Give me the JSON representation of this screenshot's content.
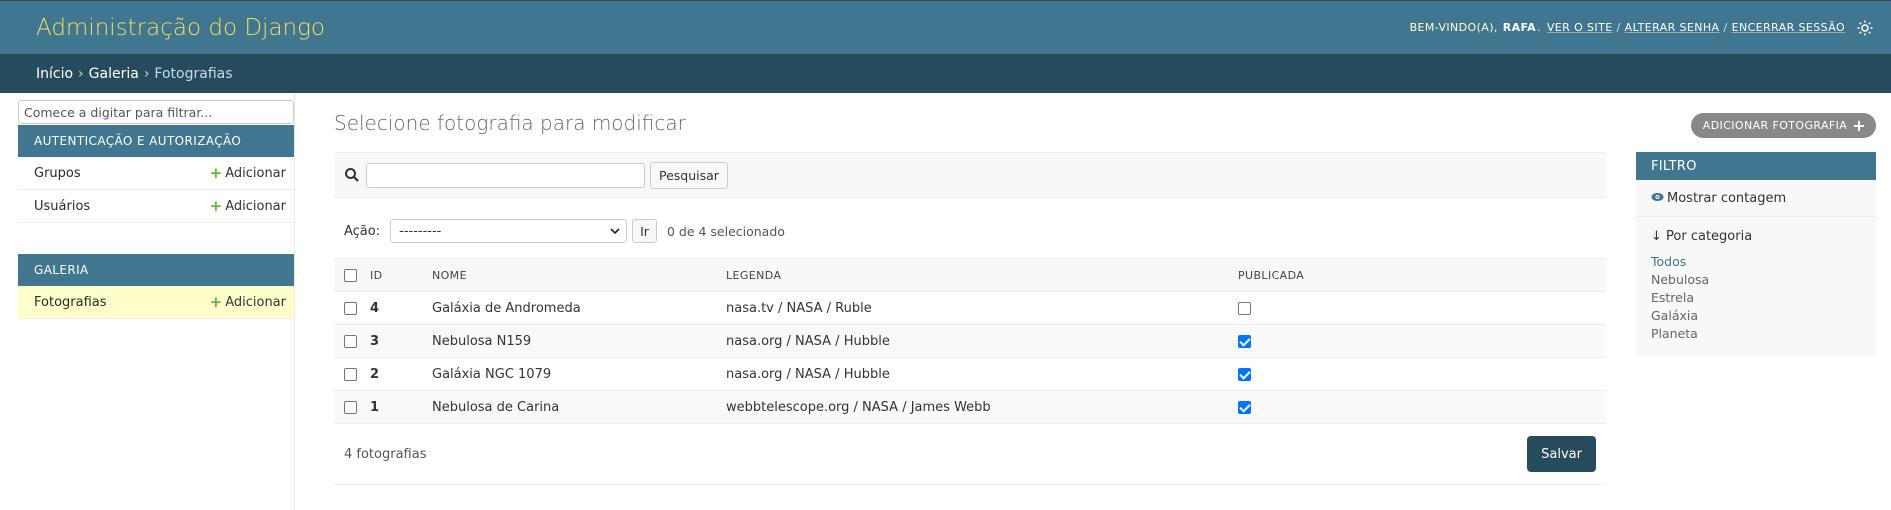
{
  "header": {
    "brand": "Administração do Django",
    "welcome": "Bem-vindo(a),",
    "username": "RAFA",
    "view_site": "Ver o site",
    "change_password": "Alterar senha",
    "logout": "Encerrar sessão",
    "sep": "/"
  },
  "breadcrumbs": {
    "home": "Início",
    "app": "Galeria",
    "current": "Fotografias",
    "arrow": "›"
  },
  "sidebar": {
    "filter_placeholder": "Comece a digitar para filtrar...",
    "apps": [
      {
        "caption": "Autenticação e Autorização",
        "models": [
          {
            "name": "Grupos",
            "add": "Adicionar"
          },
          {
            "name": "Usuários",
            "add": "Adicionar"
          }
        ]
      },
      {
        "caption": "Galeria",
        "models": [
          {
            "name": "Fotografias",
            "add": "Adicionar"
          }
        ]
      }
    ]
  },
  "content": {
    "title": "Selecione fotografia para modificar",
    "add_button": "Adicionar Fotografia",
    "search_button": "Pesquisar",
    "action_label": "Ação:",
    "action_selected": "---------",
    "go_button": "Ir",
    "selected_counter": "0 de 4 selecionado",
    "columns": [
      "ID",
      "Nome",
      "Legenda",
      "Publicada"
    ],
    "rows": [
      {
        "id": "4",
        "nome": "Galáxia de Andromeda",
        "legenda": "nasa.tv / NASA / Ruble",
        "publicada": false
      },
      {
        "id": "3",
        "nome": "Nebulosa N159",
        "legenda": "nasa.org / NASA / Hubble",
        "publicada": true
      },
      {
        "id": "2",
        "nome": "Galáxia NGC 1079",
        "legenda": "nasa.org / NASA / Hubble",
        "publicada": true
      },
      {
        "id": "1",
        "nome": "Nebulosa de Carina",
        "legenda": "webbtelescope.org / NASA / James Webb",
        "publicada": true
      }
    ],
    "result_count": "4 fotografias",
    "save_button": "Salvar"
  },
  "filter": {
    "title": "FILTRO",
    "show_count": "Mostrar contagem",
    "heading": "↓ Por categoria",
    "options": [
      "Todos",
      "Nebulosa",
      "Estrela",
      "Galáxia",
      "Planeta"
    ],
    "selected": "Todos"
  },
  "colors": {
    "header_bg": "#417690",
    "breadcrumbs_bg": "#264b5d",
    "brand": "#f5dd5d",
    "selected_row": "#ffffcc",
    "add_plus": "#6bb537"
  }
}
